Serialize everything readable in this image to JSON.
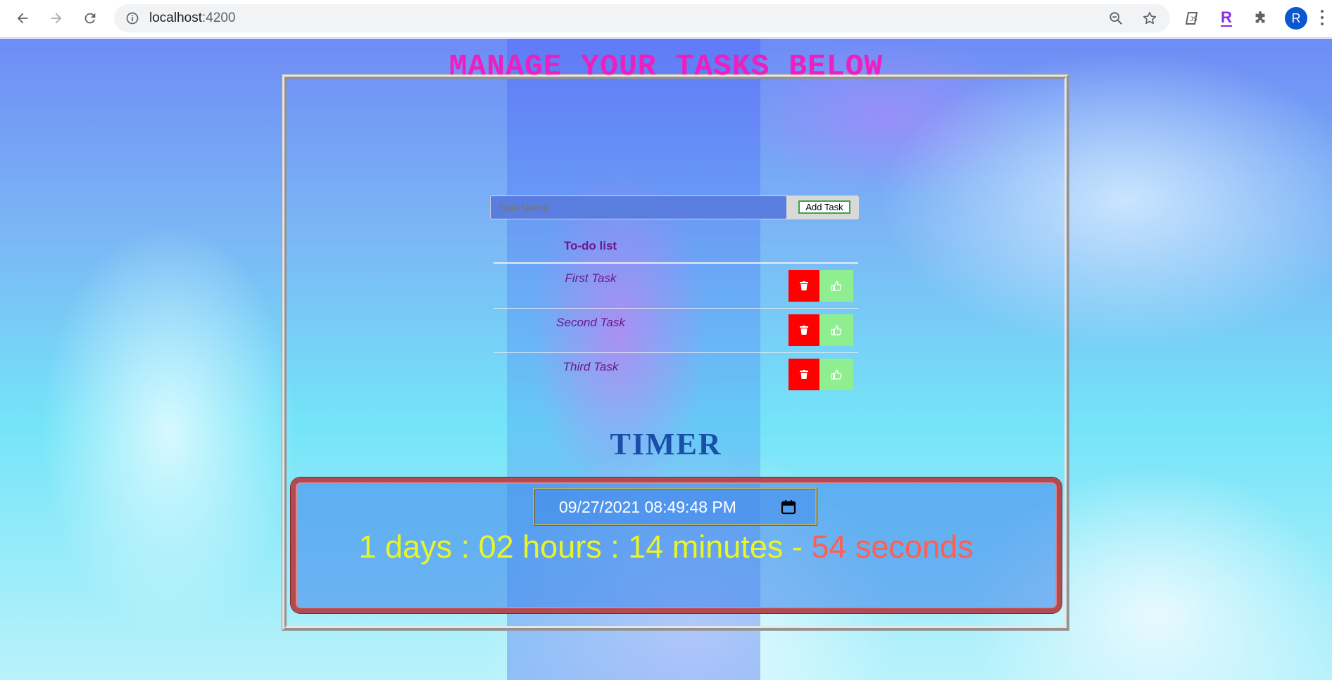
{
  "browser": {
    "url_host": "localhost",
    "url_port": ":4200",
    "avatar_letter": "R"
  },
  "page": {
    "title": "MANAGE YOUR TASKS BELOW",
    "task_input_placeholder": "Task Name",
    "add_button": "Add Task",
    "todo_header": "To-do list",
    "tasks": [
      {
        "name": "First Task"
      },
      {
        "name": "Second Task"
      },
      {
        "name": "Third Task"
      }
    ],
    "timer_title": "TIMER",
    "datetime_value": "09/27/2021 08:49:48 PM",
    "countdown": {
      "days": "1 days : ",
      "hours": "02 hours : ",
      "minutes": "14 minutes - ",
      "seconds": "54 seconds"
    }
  },
  "colors": {
    "title": "#ee1fbf",
    "delete_button": "#ff0000",
    "done_button": "#8fee8f",
    "countdown_main": "#e8f528",
    "countdown_seconds": "#ff5f52"
  },
  "icons": {
    "delete": "trash-icon",
    "done": "thumbs-up-icon",
    "calendar": "calendar-icon"
  }
}
